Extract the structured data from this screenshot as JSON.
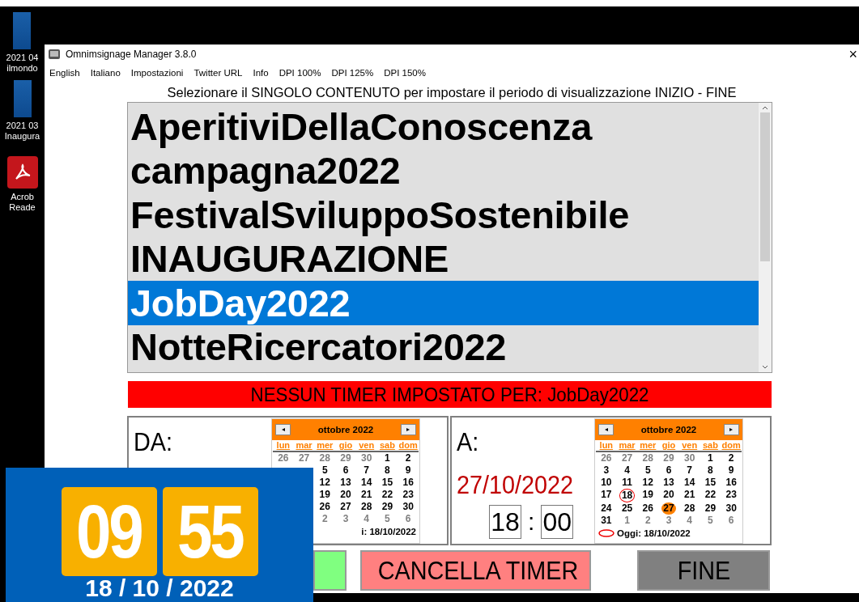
{
  "desktop": {
    "icons": [
      {
        "kind": "book",
        "lines": [
          "2021 04",
          "ilmondo"
        ]
      },
      {
        "kind": "book",
        "lines": [
          "2021 03",
          "Inaugura"
        ]
      },
      {
        "kind": "pdf",
        "lines": [
          "Acrob",
          "Reade"
        ]
      }
    ]
  },
  "window": {
    "title": "Omnimsignage Manager 3.8.0",
    "close": "×"
  },
  "menu": [
    "English",
    "Italiano",
    "Impostazioni",
    "Twitter URL",
    "Info",
    "DPI 100%",
    "DPI 125%",
    "DPI 150%"
  ],
  "instruction": "Selezionare il SINGOLO CONTENUTO per impostare il periodo di visualizzazione INIZIO - FINE",
  "content_list": [
    {
      "label": "AperitiviDellaConoscenza",
      "selected": false
    },
    {
      "label": "campagna2022",
      "selected": false
    },
    {
      "label": "FestivalSviluppoSostenibile",
      "selected": false
    },
    {
      "label": "INAUGURAZIONE",
      "selected": false
    },
    {
      "label": "JobDay2022",
      "selected": true
    },
    {
      "label": "NotteRicercatori2022",
      "selected": false
    }
  ],
  "status_banner": "NESSUN TIMER IMPOSTATO PER: JobDay2022",
  "from": {
    "label": "DA:",
    "calendar": {
      "month": "ottobre 2022",
      "prev": "◂",
      "next": "▸",
      "weekdays": [
        "lun",
        "mar",
        "mer",
        "gio",
        "ven",
        "sab",
        "dom"
      ],
      "weeks": [
        [
          {
            "d": "26",
            "muted": true,
            "today": false,
            "selected": false
          },
          {
            "d": "27",
            "muted": true,
            "today": false,
            "selected": false
          },
          {
            "d": "28",
            "muted": true,
            "today": false,
            "selected": false
          },
          {
            "d": "29",
            "muted": true,
            "today": false,
            "selected": false
          },
          {
            "d": "30",
            "muted": true,
            "today": false,
            "selected": false
          },
          {
            "d": "1",
            "muted": false,
            "today": false,
            "selected": false
          },
          {
            "d": "2",
            "muted": false,
            "today": false,
            "selected": false
          }
        ],
        [
          {
            "d": "5",
            "muted": false,
            "today": false,
            "selected": false
          },
          {
            "d": "6",
            "muted": false,
            "today": false,
            "selected": false
          },
          {
            "d": "7",
            "muted": false,
            "today": false,
            "selected": false
          },
          {
            "d": "8",
            "muted": false,
            "today": false,
            "selected": false
          },
          {
            "d": "9",
            "muted": false,
            "today": false,
            "selected": false
          }
        ],
        [
          {
            "d": "12",
            "muted": false,
            "today": false,
            "selected": false
          },
          {
            "d": "13",
            "muted": false,
            "today": false,
            "selected": false
          },
          {
            "d": "14",
            "muted": false,
            "today": false,
            "selected": false
          },
          {
            "d": "15",
            "muted": false,
            "today": false,
            "selected": false
          },
          {
            "d": "16",
            "muted": false,
            "today": false,
            "selected": false
          }
        ],
        [
          {
            "d": "19",
            "muted": false,
            "today": false,
            "selected": false
          },
          {
            "d": "20",
            "muted": false,
            "today": false,
            "selected": false
          },
          {
            "d": "21",
            "muted": false,
            "today": false,
            "selected": false
          },
          {
            "d": "22",
            "muted": false,
            "today": false,
            "selected": false
          },
          {
            "d": "23",
            "muted": false,
            "today": false,
            "selected": false
          }
        ],
        [
          {
            "d": "26",
            "muted": false,
            "today": false,
            "selected": false
          },
          {
            "d": "27",
            "muted": false,
            "today": false,
            "selected": false
          },
          {
            "d": "28",
            "muted": false,
            "today": false,
            "selected": false
          },
          {
            "d": "29",
            "muted": false,
            "today": false,
            "selected": false
          },
          {
            "d": "30",
            "muted": false,
            "today": false,
            "selected": false
          }
        ],
        [
          {
            "d": "2",
            "muted": true,
            "today": false,
            "selected": false
          },
          {
            "d": "3",
            "muted": true,
            "today": false,
            "selected": false
          },
          {
            "d": "4",
            "muted": true,
            "today": false,
            "selected": false
          },
          {
            "d": "5",
            "muted": true,
            "today": false,
            "selected": false
          },
          {
            "d": "6",
            "muted": true,
            "today": false,
            "selected": false
          }
        ]
      ],
      "footer": "i: 18/10/2022"
    }
  },
  "to": {
    "label": "A:",
    "date": "27/10/2022",
    "hour": "18",
    "minute": "00",
    "separator": ":",
    "calendar": {
      "month": "ottobre 2022",
      "prev": "◂",
      "next": "▸",
      "weekdays": [
        "lun",
        "mar",
        "mer",
        "gio",
        "ven",
        "sab",
        "dom"
      ],
      "weeks": [
        [
          {
            "d": "26",
            "muted": true,
            "today": false,
            "selected": false
          },
          {
            "d": "27",
            "muted": true,
            "today": false,
            "selected": false
          },
          {
            "d": "28",
            "muted": true,
            "today": false,
            "selected": false
          },
          {
            "d": "29",
            "muted": true,
            "today": false,
            "selected": false
          },
          {
            "d": "30",
            "muted": true,
            "today": false,
            "selected": false
          },
          {
            "d": "1",
            "muted": false,
            "today": false,
            "selected": false
          },
          {
            "d": "2",
            "muted": false,
            "today": false,
            "selected": false
          }
        ],
        [
          {
            "d": "3",
            "muted": false,
            "today": false,
            "selected": false
          },
          {
            "d": "4",
            "muted": false,
            "today": false,
            "selected": false
          },
          {
            "d": "5",
            "muted": false,
            "today": false,
            "selected": false
          },
          {
            "d": "6",
            "muted": false,
            "today": false,
            "selected": false
          },
          {
            "d": "7",
            "muted": false,
            "today": false,
            "selected": false
          },
          {
            "d": "8",
            "muted": false,
            "today": false,
            "selected": false
          },
          {
            "d": "9",
            "muted": false,
            "today": false,
            "selected": false
          }
        ],
        [
          {
            "d": "10",
            "muted": false,
            "today": false,
            "selected": false
          },
          {
            "d": "11",
            "muted": false,
            "today": false,
            "selected": false
          },
          {
            "d": "12",
            "muted": false,
            "today": false,
            "selected": false
          },
          {
            "d": "13",
            "muted": false,
            "today": false,
            "selected": false
          },
          {
            "d": "14",
            "muted": false,
            "today": false,
            "selected": false
          },
          {
            "d": "15",
            "muted": false,
            "today": false,
            "selected": false
          },
          {
            "d": "16",
            "muted": false,
            "today": false,
            "selected": false
          }
        ],
        [
          {
            "d": "17",
            "muted": false,
            "today": false,
            "selected": false
          },
          {
            "d": "18",
            "muted": false,
            "today": true,
            "selected": false
          },
          {
            "d": "19",
            "muted": false,
            "today": false,
            "selected": false
          },
          {
            "d": "20",
            "muted": false,
            "today": false,
            "selected": false
          },
          {
            "d": "21",
            "muted": false,
            "today": false,
            "selected": false
          },
          {
            "d": "22",
            "muted": false,
            "today": false,
            "selected": false
          },
          {
            "d": "23",
            "muted": false,
            "today": false,
            "selected": false
          }
        ],
        [
          {
            "d": "24",
            "muted": false,
            "today": false,
            "selected": false
          },
          {
            "d": "25",
            "muted": false,
            "today": false,
            "selected": false
          },
          {
            "d": "26",
            "muted": false,
            "today": false,
            "selected": false
          },
          {
            "d": "27",
            "muted": false,
            "today": false,
            "selected": true
          },
          {
            "d": "28",
            "muted": false,
            "today": false,
            "selected": false
          },
          {
            "d": "29",
            "muted": false,
            "today": false,
            "selected": false
          },
          {
            "d": "30",
            "muted": false,
            "today": false,
            "selected": false
          }
        ],
        [
          {
            "d": "31",
            "muted": false,
            "today": false,
            "selected": false
          },
          {
            "d": "1",
            "muted": true,
            "today": false,
            "selected": false
          },
          {
            "d": "2",
            "muted": true,
            "today": false,
            "selected": false
          },
          {
            "d": "3",
            "muted": true,
            "today": false,
            "selected": false
          },
          {
            "d": "4",
            "muted": true,
            "today": false,
            "selected": false
          },
          {
            "d": "5",
            "muted": true,
            "today": false,
            "selected": false
          },
          {
            "d": "6",
            "muted": true,
            "today": false,
            "selected": false
          }
        ]
      ],
      "footer": "Oggi: 18/10/2022",
      "today_mark": true
    }
  },
  "buttons": [
    {
      "kind": "confirm"
    },
    {
      "kind": "cancel",
      "label": "CANCELLA TIMER"
    },
    {
      "kind": "finish",
      "label": "FINE"
    }
  ],
  "clock": {
    "hours": "09",
    "minutes": "55",
    "date": "18 / 10 / 2022"
  }
}
